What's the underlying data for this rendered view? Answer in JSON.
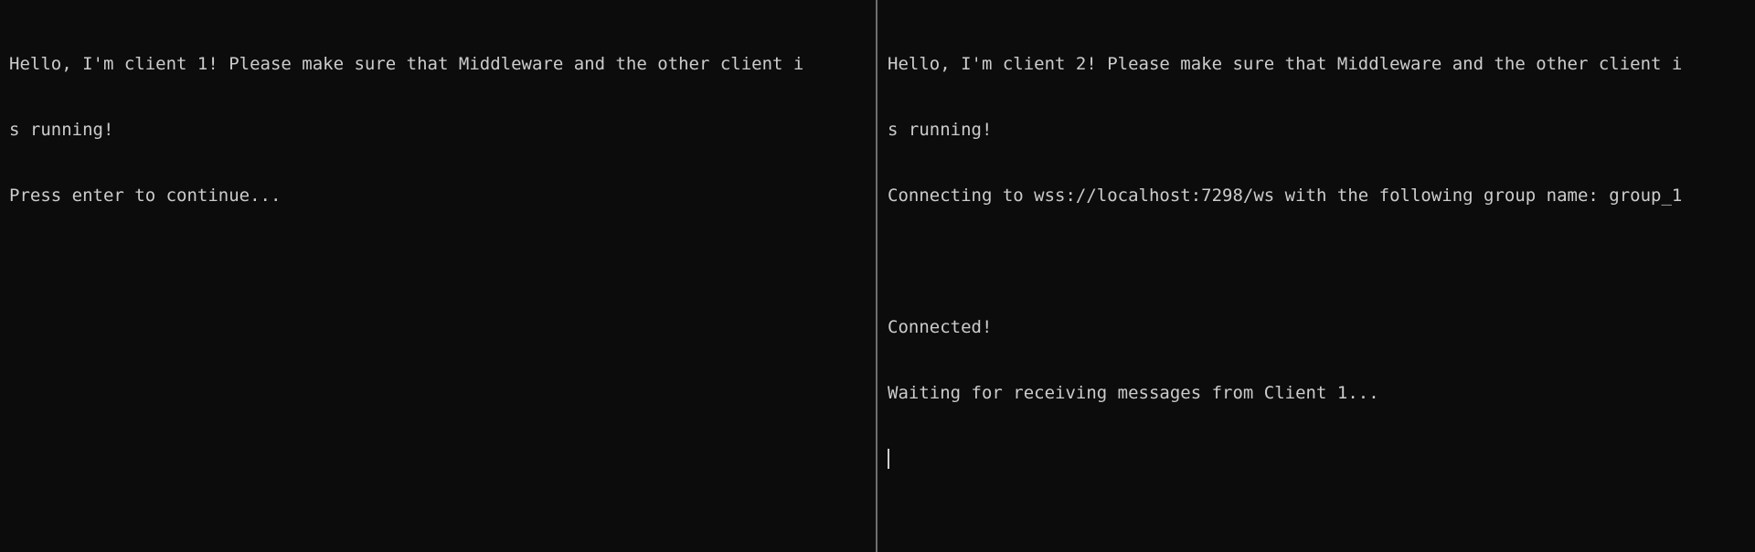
{
  "panes": {
    "left": {
      "lines": [
        "Hello, I'm client 1! Please make sure that Middleware and the other client i",
        "s running!",
        "Press enter to continue..."
      ]
    },
    "right": {
      "lines": [
        "Hello, I'm client 2! Please make sure that Middleware and the other client i",
        "s running!",
        "Connecting to wss://localhost:7298/ws with the following group name: group_1",
        "",
        "Connected!",
        "Waiting for receiving messages from Client 1..."
      ]
    }
  },
  "colors": {
    "background": "#0c0c0c",
    "text": "#cccccc",
    "divider": "#6e6e6e"
  }
}
